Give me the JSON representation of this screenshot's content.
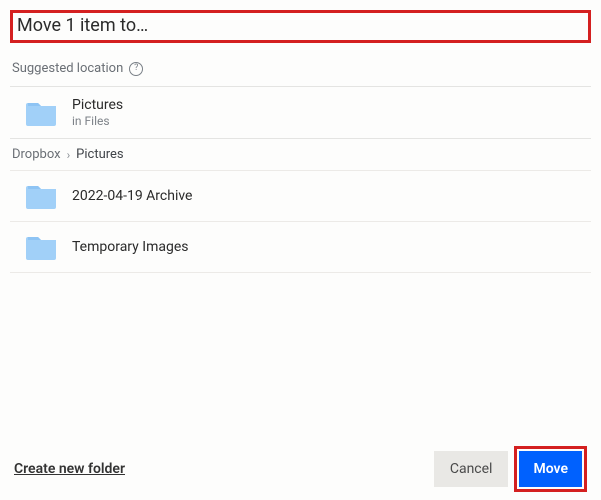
{
  "dialog": {
    "title": "Move 1 item to…"
  },
  "suggested": {
    "label": "Suggested location",
    "item": {
      "name": "Pictures",
      "sub": "in Files"
    }
  },
  "breadcrumb": {
    "root": "Dropbox",
    "current": "Pictures"
  },
  "folders": [
    {
      "name": "2022-04-19 Archive"
    },
    {
      "name": "Temporary Images"
    }
  ],
  "footer": {
    "create": "Create new folder",
    "cancel": "Cancel",
    "move": "Move"
  }
}
